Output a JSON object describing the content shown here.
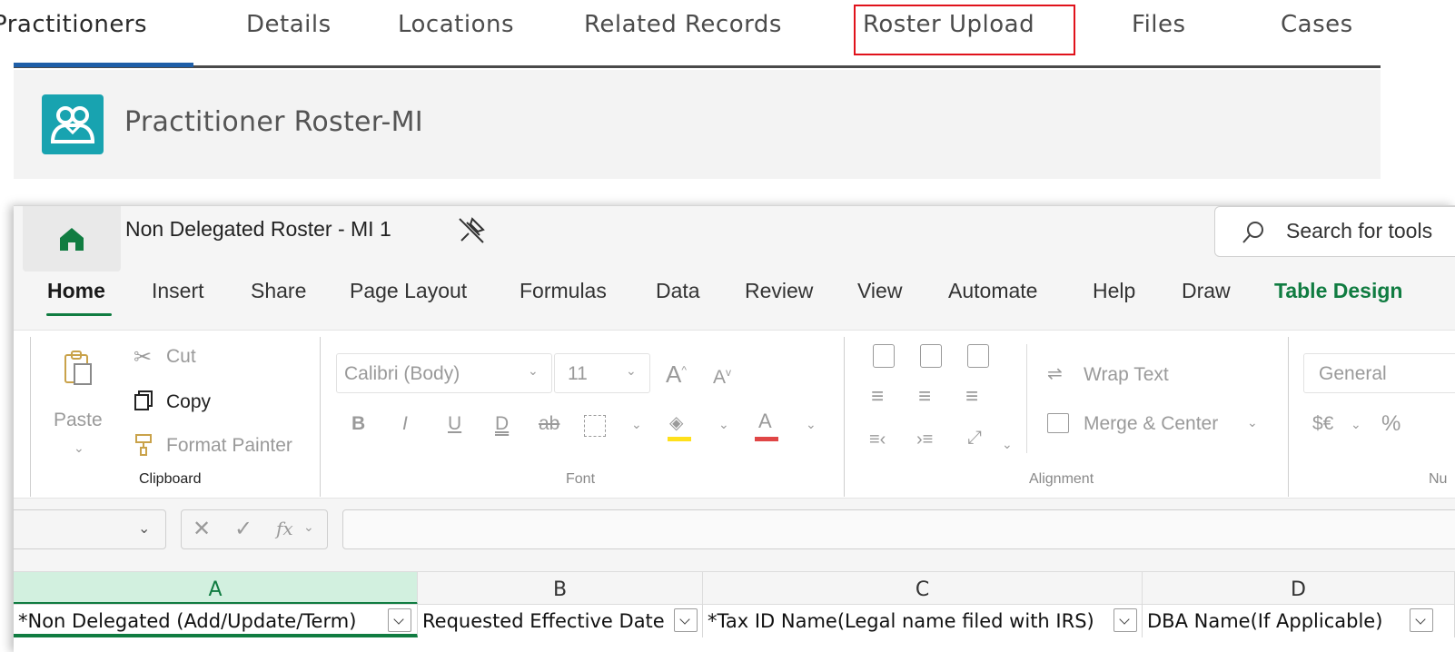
{
  "top_tabs": [
    {
      "label": "Practitioners",
      "active": true
    },
    {
      "label": "Details"
    },
    {
      "label": "Locations"
    },
    {
      "label": "Related Records"
    },
    {
      "label": "Roster Upload",
      "highlighted": true
    },
    {
      "label": "Files"
    },
    {
      "label": "Cases"
    }
  ],
  "record": {
    "title": "Practitioner Roster-MI",
    "icon": "group-contacts-icon",
    "icon_color": "#18a3b0"
  },
  "excel": {
    "doc_title": "Non Delegated Roster - MI 1",
    "search_text": "Search for tools",
    "menu": [
      "Home",
      "Insert",
      "Share",
      "Page Layout",
      "Formulas",
      "Data",
      "Review",
      "View",
      "Automate",
      "Help",
      "Draw",
      "Table Design"
    ],
    "clipboard": {
      "paste": "Paste",
      "cut": "Cut",
      "copy": "Copy",
      "format_painter": "Format Painter",
      "group": "Clipboard"
    },
    "font": {
      "family": "Calibri (Body)",
      "size": "11",
      "group": "Font"
    },
    "alignment": {
      "wrap_text": "Wrap Text",
      "merge_center": "Merge & Center",
      "group": "Alignment"
    },
    "number": {
      "format": "General",
      "currency": "$€",
      "percent": "%",
      "group": "Nu"
    },
    "columns": [
      "A",
      "B",
      "C",
      "D"
    ],
    "header_row": [
      "*Non Delegated (Add/Update/Term)",
      "Requested Effective Date",
      "*Tax ID Name(Legal name filed with IRS)",
      "DBA Name(If Applicable)"
    ],
    "accent_green": "#107c41",
    "highlight_red": "#e0121b"
  }
}
